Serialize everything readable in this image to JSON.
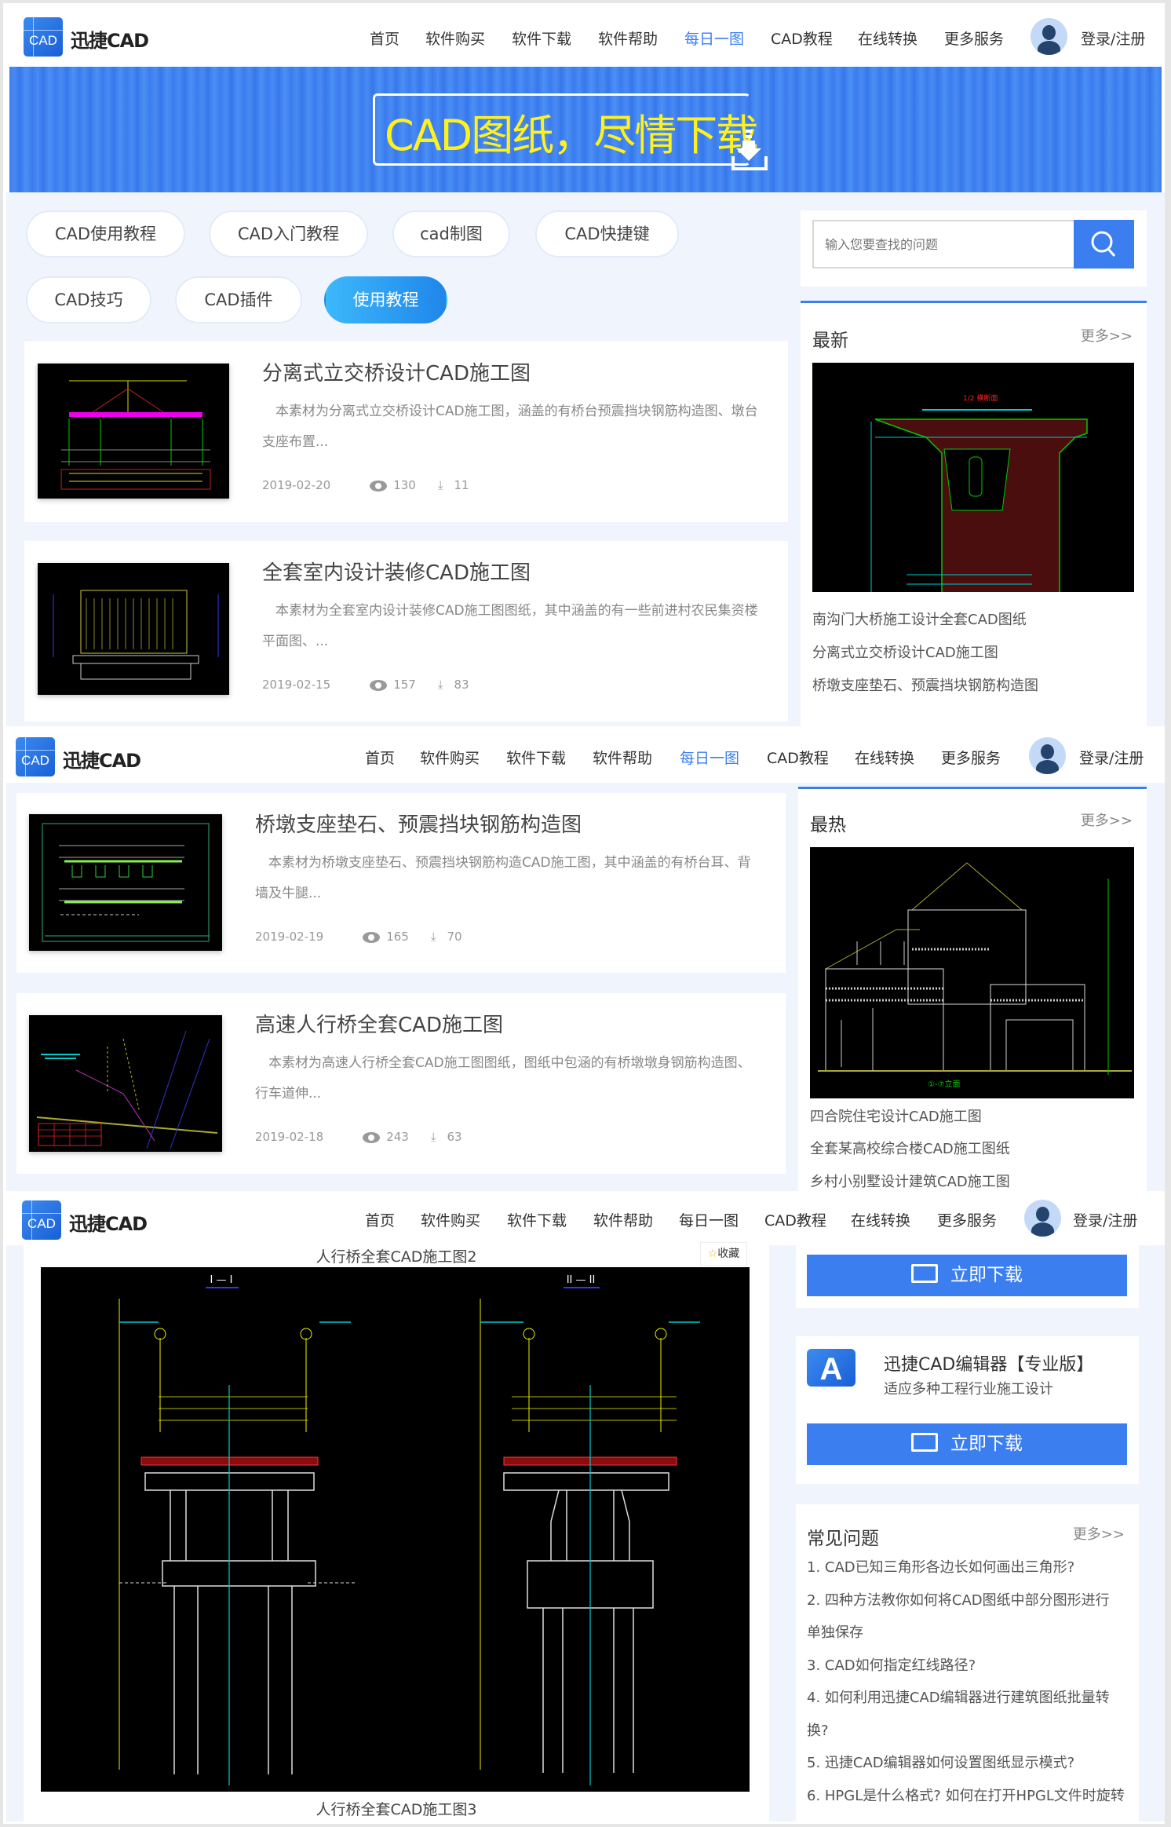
{
  "brand": "迅捷CAD",
  "logo_text": "CAD",
  "nav": [
    "首页",
    "软件购买",
    "软件下载",
    "软件帮助",
    "每日一图",
    "CAD教程",
    "在线转换",
    "更多服务"
  ],
  "login": "登录/注册",
  "banner": {
    "text": "CAD图纸，尽情下载"
  },
  "tags": [
    "CAD使用教程",
    "CAD入门教程",
    "cad制图",
    "CAD快捷键",
    "CAD技巧",
    "CAD插件",
    "使用教程"
  ],
  "search": {
    "placeholder": "输入您要查找的问题"
  },
  "articles": [
    {
      "title": "分离式立交桥设计CAD施工图",
      "desc": "本素材为分离式立交桥设计CAD施工图，涵盖的有桥台预震挡块钢筋构造图、墩台支座布置...",
      "date": "2019-02-20",
      "views": "130",
      "downloads": "11"
    },
    {
      "title": "全套室内设计装修CAD施工图",
      "desc": "本素材为全套室内设计装修CAD施工图图纸，其中涵盖的有一些前进村农民集资楼平面图、...",
      "date": "2019-02-15",
      "views": "157",
      "downloads": "83"
    },
    {
      "title": "桥墩支座垫石、预震挡块钢筋构造图",
      "desc": "本素材为桥墩支座垫石、预震挡块钢筋构造CAD施工图，其中涵盖的有桥台耳、背墙及牛腿...",
      "date": "2019-02-19",
      "views": "165",
      "downloads": "70"
    },
    {
      "title": "高速人行桥全套CAD施工图",
      "desc": "本素材为高速人行桥全套CAD施工图图纸，图纸中包涵的有桥墩墩身钢筋构造图、行车道伸...",
      "date": "2019-02-18",
      "views": "243",
      "downloads": "63"
    }
  ],
  "latest": {
    "title": "最新",
    "more": "更多>>",
    "links": [
      "南沟门大桥施工设计全套CAD图纸",
      "分离式立交桥设计CAD施工图",
      "桥墩支座垫石、预震挡块钢筋构造图"
    ]
  },
  "hot": {
    "title": "最热",
    "more": "更多>>",
    "links": [
      "四合院住宅设计CAD施工图",
      "全套某高校综合楼CAD施工图纸",
      "乡村小别墅设计建筑CAD施工图"
    ]
  },
  "detail": {
    "top_caption": "人行桥全套CAD施工图2",
    "bottom_caption": "人行桥全套CAD施工图3",
    "favorite": "收藏",
    "section_left": "I — I",
    "section_right": "II — II"
  },
  "download": {
    "label": "立即下载"
  },
  "product": {
    "name": "迅捷CAD编辑器【专业版】",
    "subtitle": "适应多种工程行业施工设计",
    "icon_letter": "A"
  },
  "faq": {
    "title": "常见问题",
    "more": "更多>>",
    "items": [
      "1. CAD已知三角形各边长如何画出三角形?",
      "2. 四种方法教你如何将CAD图纸中部分图形进行单独保存",
      "3. CAD如何指定红线路径?",
      "4. 如何利用迅捷CAD编辑器进行建筑图纸批量转换?",
      "5. 迅捷CAD编辑器如何设置图纸显示模式?",
      "6. HPGL是什么格式? 如何在打开HPGL文件时旋转"
    ]
  },
  "colors": {
    "accent": "#3a7ef0",
    "banner_text": "#fff21c",
    "page_bg": "#f0f5fd"
  }
}
